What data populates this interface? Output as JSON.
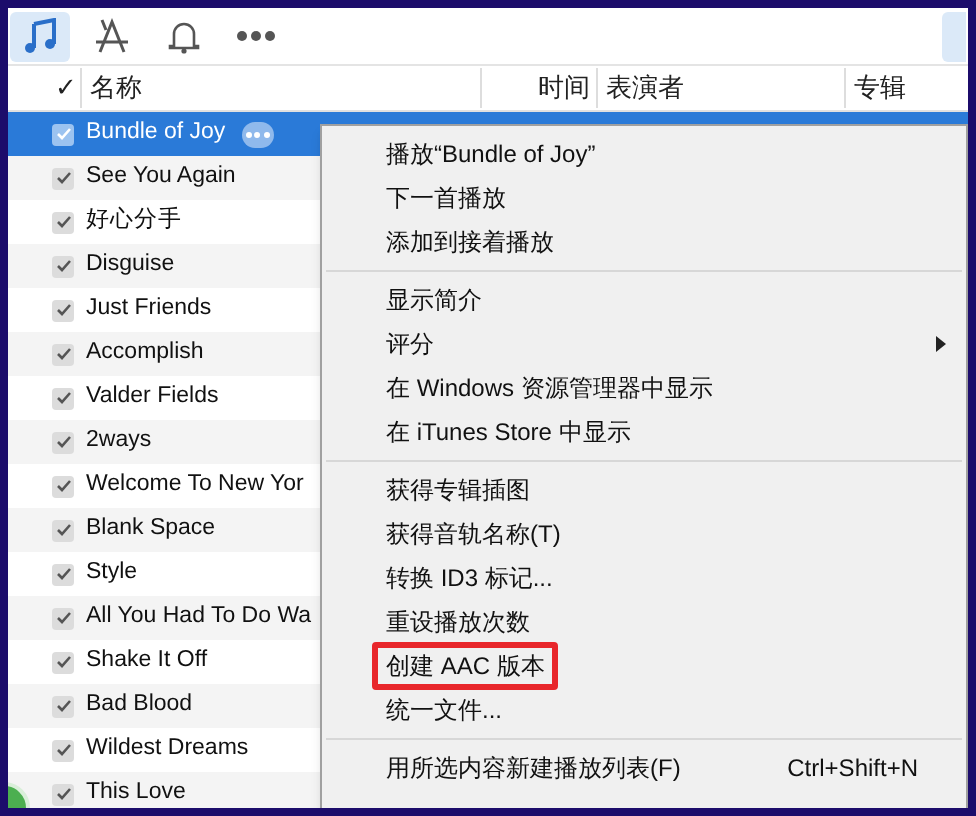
{
  "toolbar": {
    "tabs": [
      {
        "kind": "music",
        "selected": true
      },
      {
        "kind": "apps",
        "selected": false
      },
      {
        "kind": "bell",
        "selected": false
      },
      {
        "kind": "more",
        "selected": false
      }
    ]
  },
  "table": {
    "columns": [
      "✓",
      "名称",
      "时间",
      "表演者",
      "专辑"
    ],
    "rows": [
      {
        "name": "Bundle of Joy",
        "checked": true,
        "selected": true
      },
      {
        "name": "See You Again",
        "checked": true,
        "selected": false
      },
      {
        "name": "好心分手",
        "checked": true,
        "selected": false
      },
      {
        "name": "Disguise",
        "checked": true,
        "selected": false
      },
      {
        "name": "Just Friends",
        "checked": true,
        "selected": false
      },
      {
        "name": "Accomplish",
        "checked": true,
        "selected": false
      },
      {
        "name": "Valder Fields",
        "checked": true,
        "selected": false
      },
      {
        "name": "2ways",
        "checked": true,
        "selected": false
      },
      {
        "name": "Welcome To New Yor",
        "checked": true,
        "selected": false
      },
      {
        "name": "Blank Space",
        "checked": true,
        "selected": false
      },
      {
        "name": "Style",
        "checked": true,
        "selected": false
      },
      {
        "name": "All You Had To Do Wa",
        "checked": true,
        "selected": false
      },
      {
        "name": "Shake It Off",
        "checked": true,
        "selected": false
      },
      {
        "name": "Bad Blood",
        "checked": true,
        "selected": false
      },
      {
        "name": "Wildest Dreams",
        "checked": true,
        "selected": false
      },
      {
        "name": "This Love",
        "checked": true,
        "selected": false
      }
    ]
  },
  "context_menu": {
    "groups": [
      [
        {
          "label": "播放“Bundle of Joy”"
        },
        {
          "label": "下一首播放"
        },
        {
          "label": "添加到接着播放"
        }
      ],
      [
        {
          "label": "显示简介"
        },
        {
          "label": "评分",
          "submenu": true
        },
        {
          "label": "在 Windows 资源管理器中显示"
        },
        {
          "label": "在 iTunes Store 中显示"
        }
      ],
      [
        {
          "label": "获得专辑插图"
        },
        {
          "label": "获得音轨名称(T)"
        },
        {
          "label": "转换 ID3 标记..."
        },
        {
          "label": "重设播放次数"
        },
        {
          "label": "创建 AAC 版本",
          "highlighted": true
        },
        {
          "label": "统一文件..."
        }
      ],
      [
        {
          "label": "用所选内容新建播放列表(F)",
          "shortcut": "Ctrl+Shift+N"
        }
      ]
    ]
  }
}
